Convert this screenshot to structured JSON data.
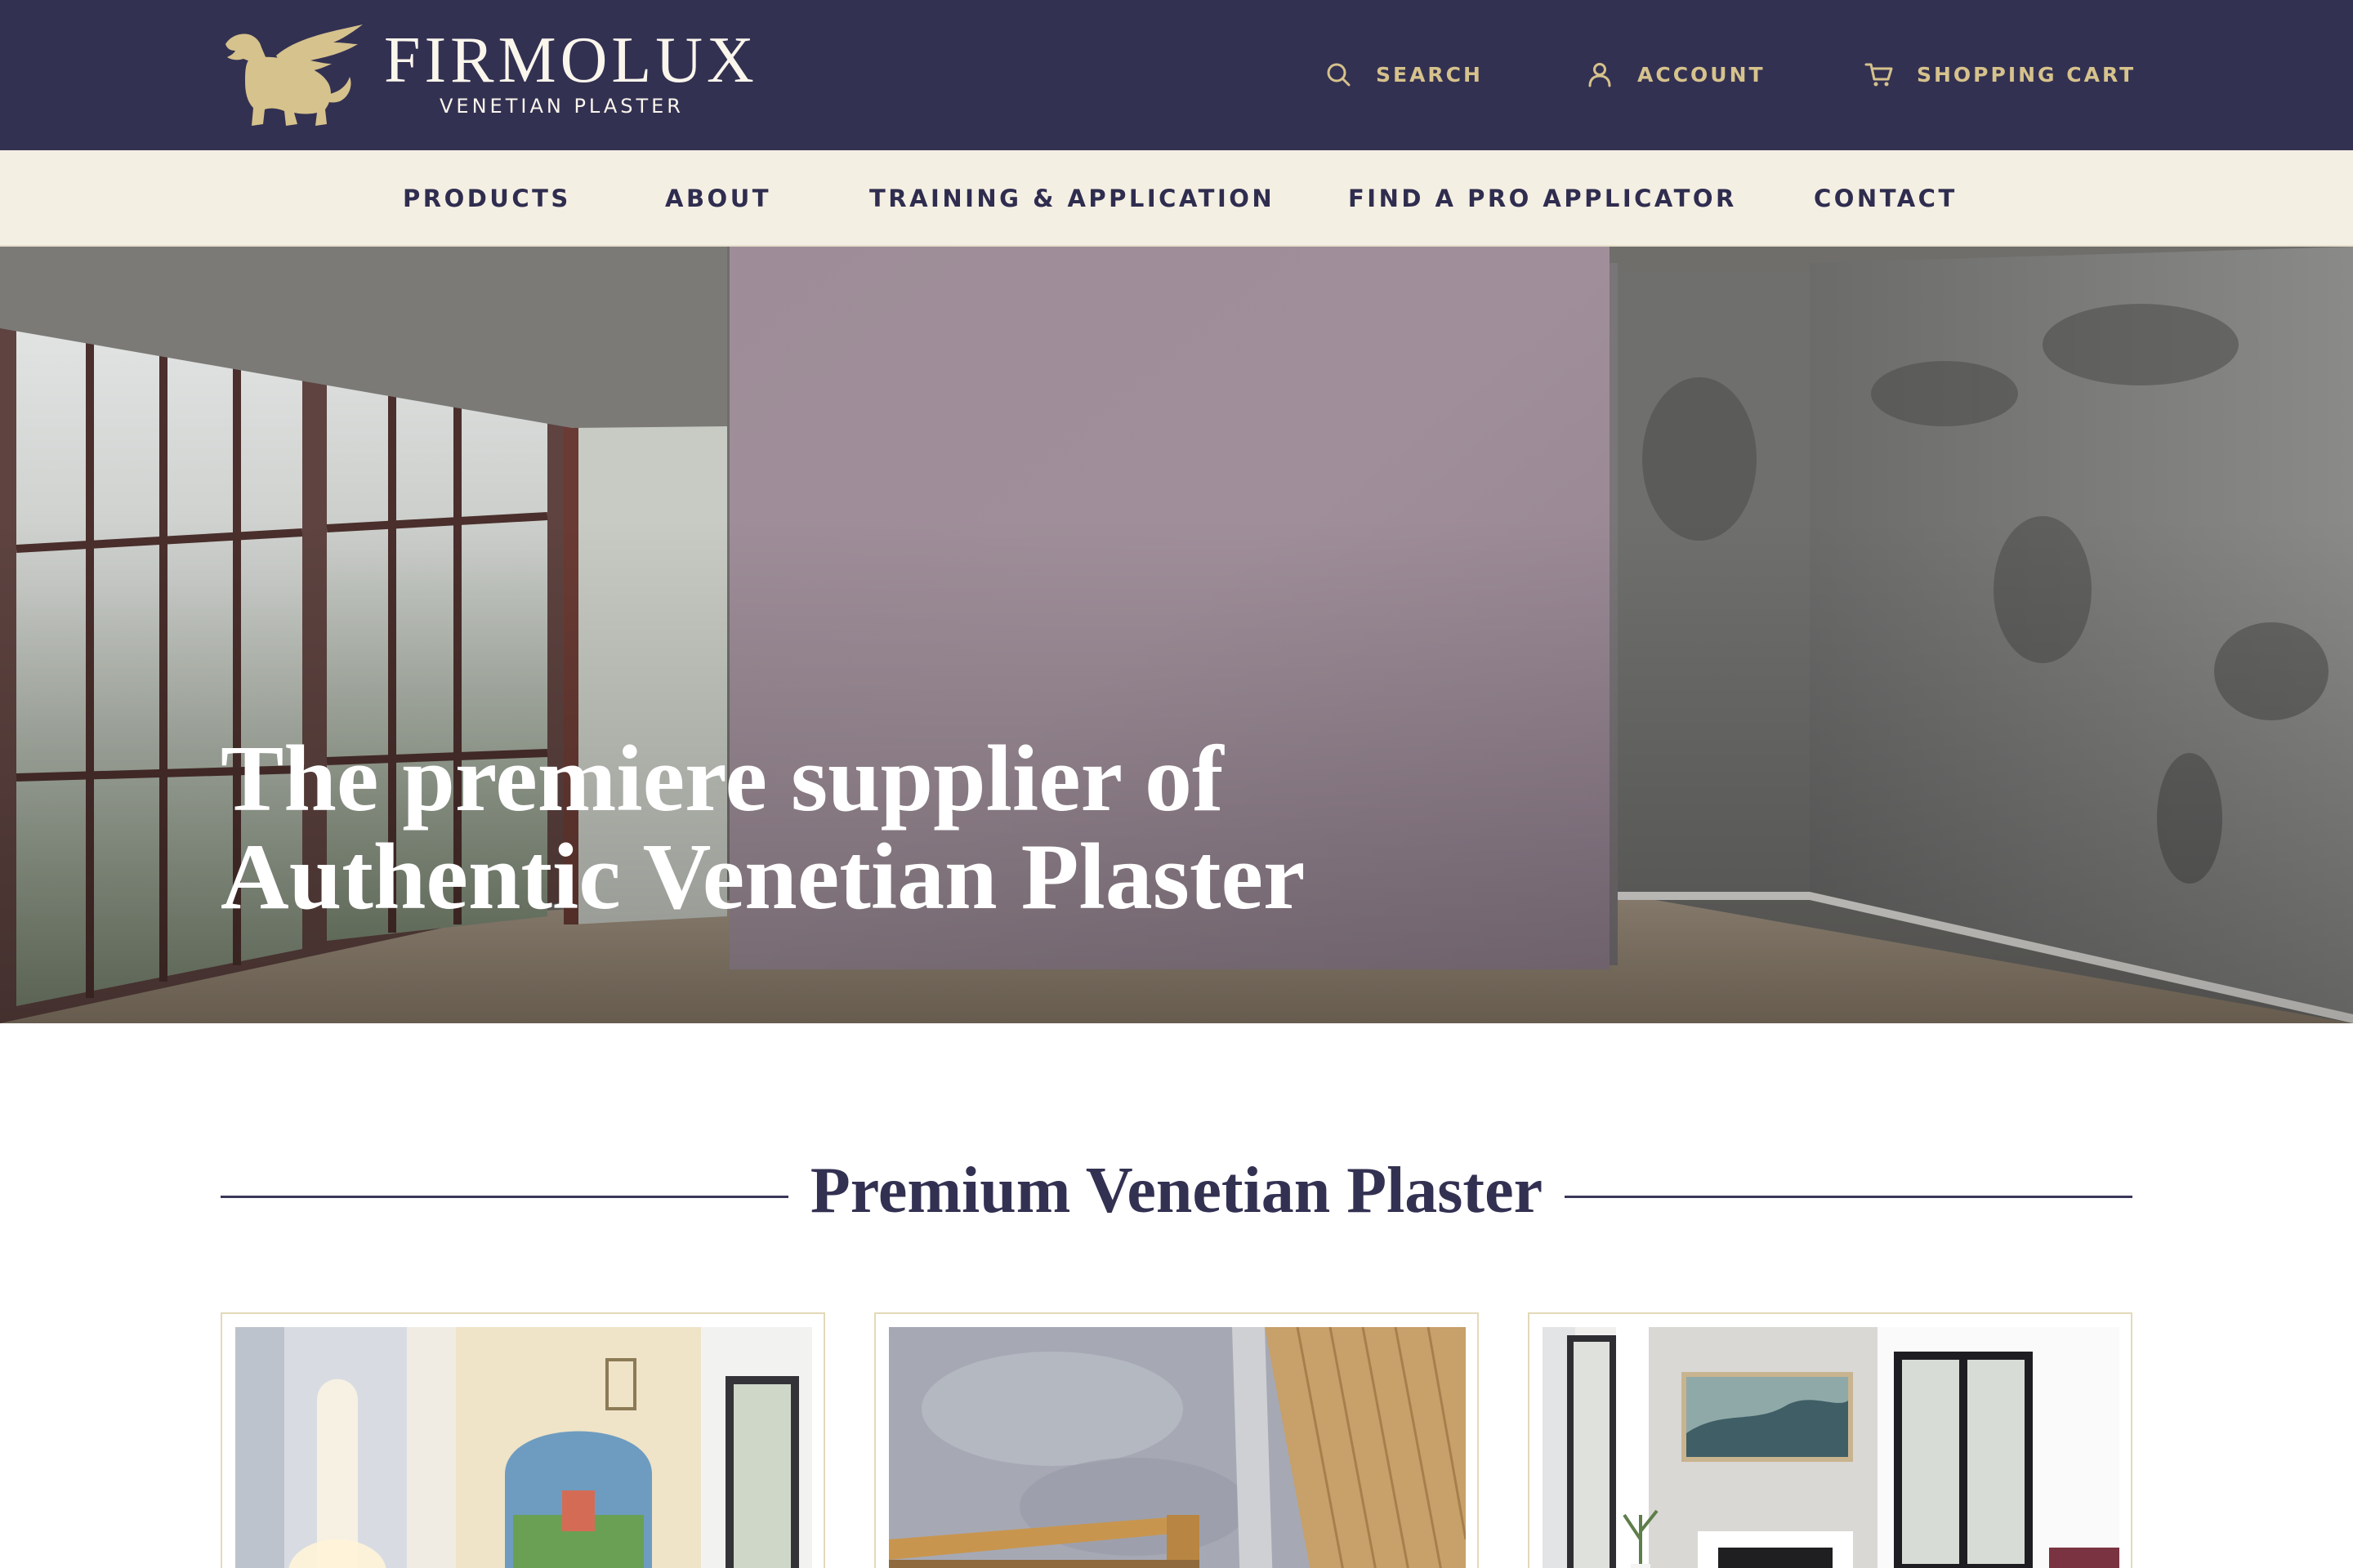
{
  "brand": {
    "name": "FIRMOLUX",
    "tagline": "VENETIAN PLASTER",
    "logo_icon": "griffin-icon",
    "color_primary": "#333152",
    "color_accent": "#d6c28c",
    "color_cream": "#f4efe3"
  },
  "utility_nav": {
    "search": {
      "label": "SEARCH",
      "icon": "search-icon"
    },
    "account": {
      "label": "ACCOUNT",
      "icon": "user-icon"
    },
    "cart": {
      "label": "SHOPPING CART",
      "icon": "cart-icon"
    }
  },
  "main_nav": {
    "items": [
      {
        "label": "PRODUCTS"
      },
      {
        "label": "ABOUT"
      },
      {
        "label": "TRAINING & APPLICATION"
      },
      {
        "label": "FIND A PRO APPLICATOR"
      },
      {
        "label": "CONTACT"
      }
    ]
  },
  "hero": {
    "title_line1": "The premiere supplier of",
    "title_line2": "Authentic Venetian Plaster"
  },
  "section": {
    "title": "Premium Venetian Plaster"
  },
  "products": {
    "cards": [
      {
        "image": "hallway-mural"
      },
      {
        "image": "plaster-wall-wood-stair"
      },
      {
        "image": "living-room-fireplace"
      }
    ]
  }
}
